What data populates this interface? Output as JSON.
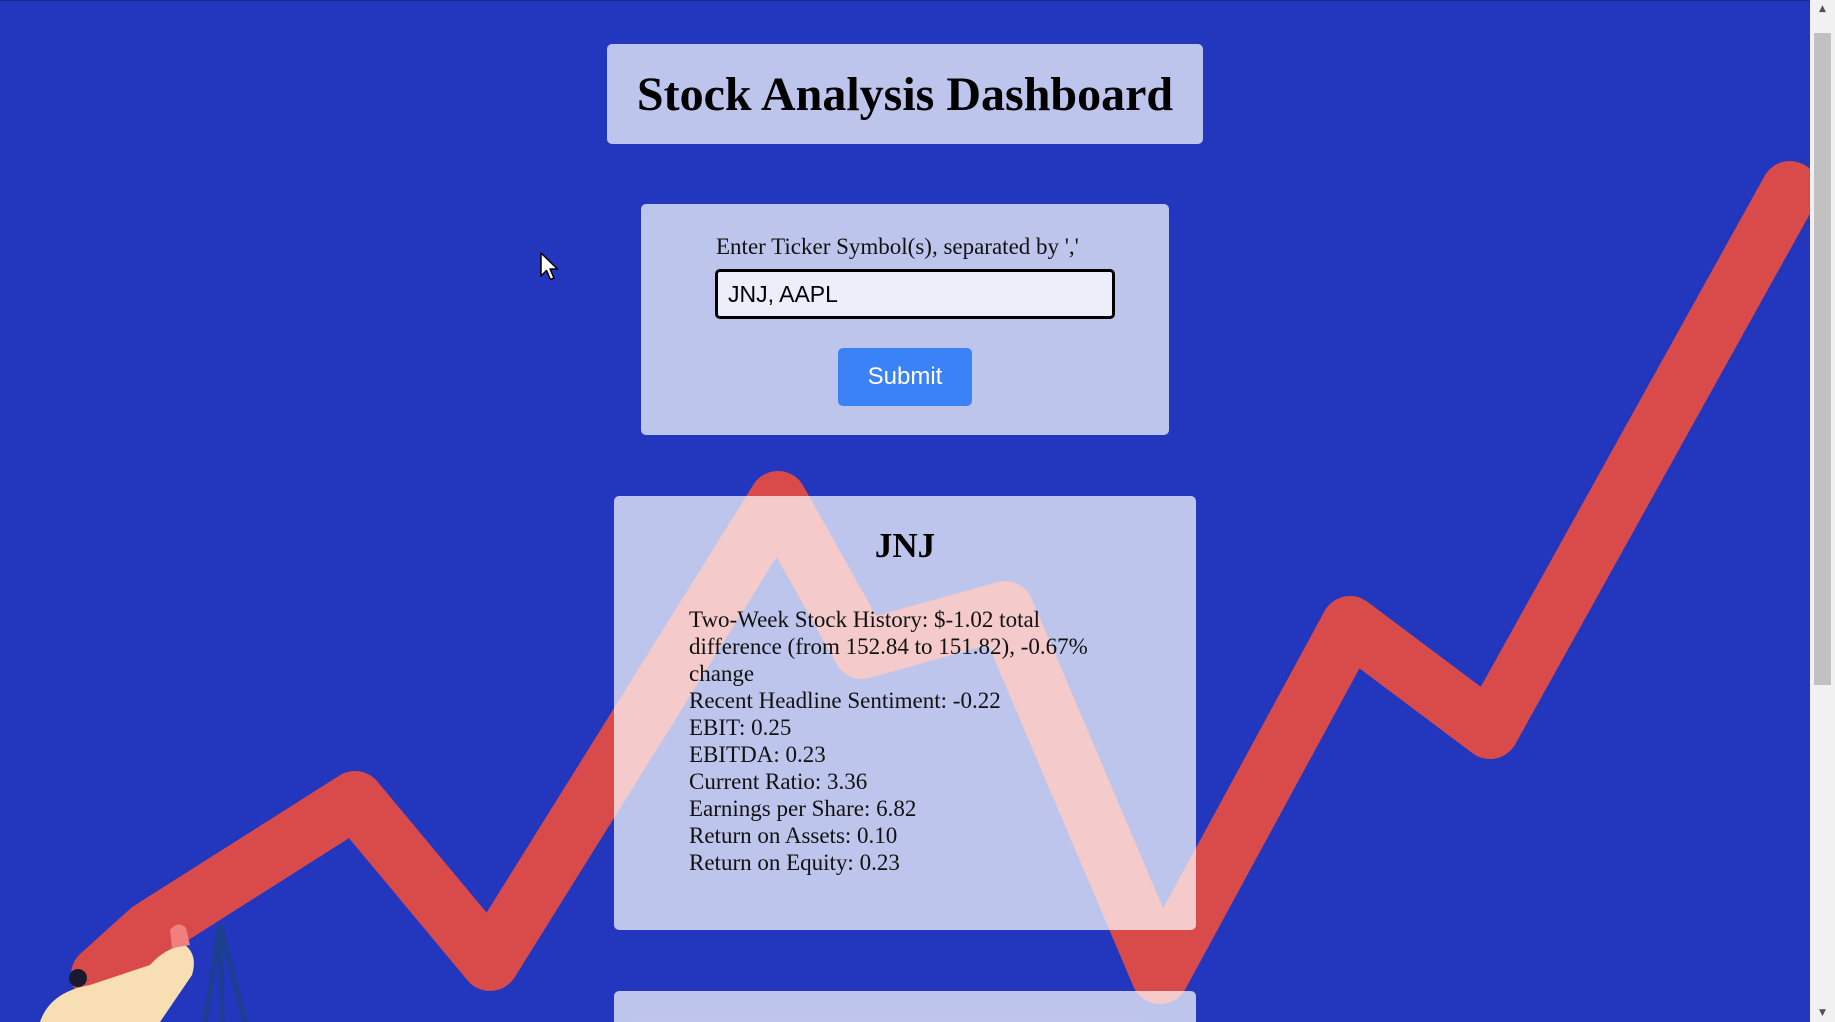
{
  "header": {
    "title": "Stock Analysis Dashboard"
  },
  "form": {
    "label": "Enter Ticker Symbol(s), separated by ','",
    "input_value": "JNJ, AAPL",
    "submit_label": "Submit"
  },
  "results": [
    {
      "ticker": "JNJ",
      "metrics": [
        "Two-Week Stock History: $-1.02 total difference (from 152.84 to 151.82), -0.67% change",
        "Recent Headline Sentiment: -0.22",
        "EBIT: 0.25",
        "EBITDA: 0.23",
        "Current Ratio: 3.36",
        "Earnings per Share: 6.82",
        "Return on Assets: 0.10",
        "Return on Equity: 0.23"
      ]
    }
  ],
  "colors": {
    "background": "#2237bd",
    "trend_line": "#d94b4b",
    "button": "#3b82f6"
  },
  "icons": {
    "cursor": "mouse-pointer-icon",
    "scroll_up": "chevron-up-icon",
    "scroll_down": "chevron-down-icon"
  }
}
